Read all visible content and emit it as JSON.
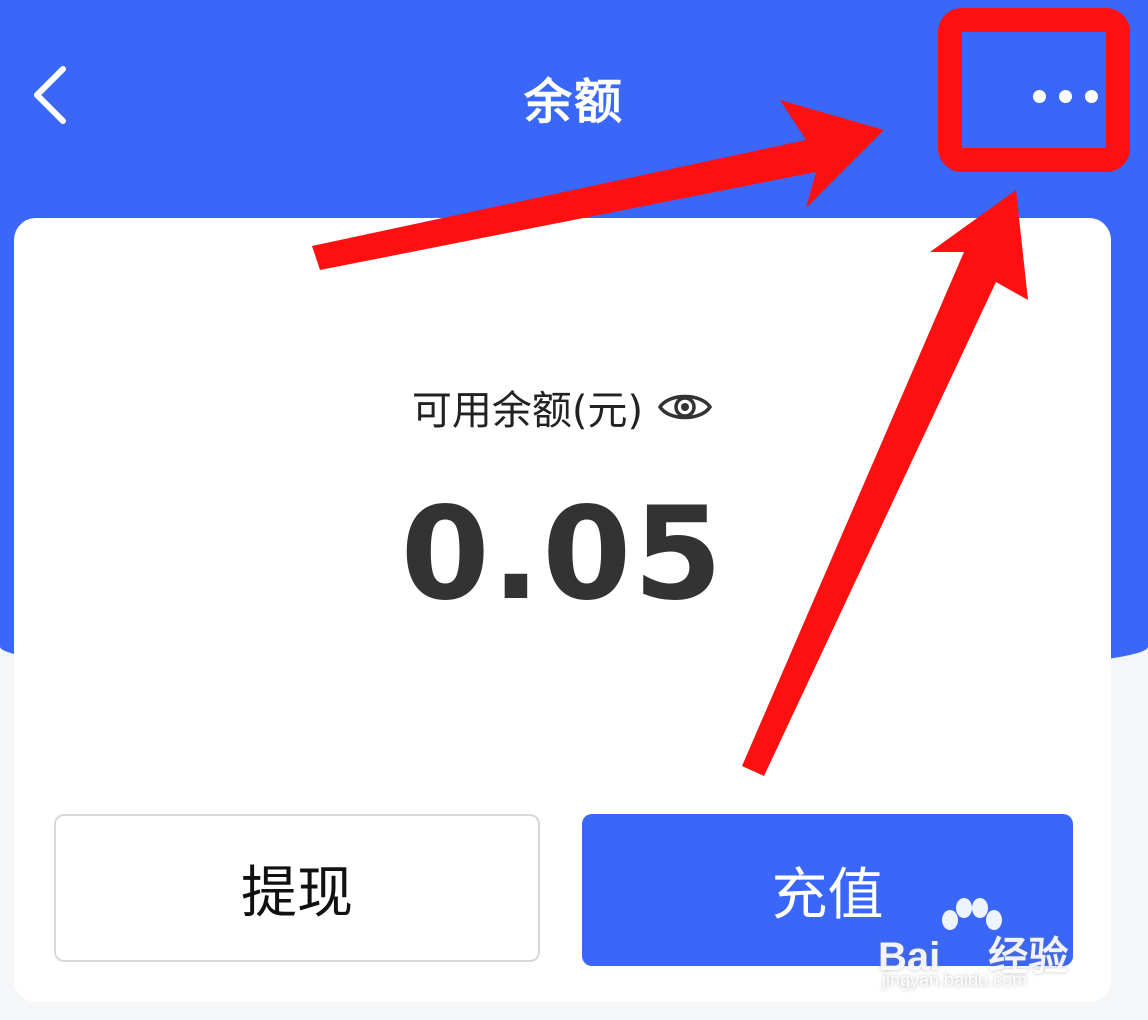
{
  "header": {
    "title": "余额",
    "back_icon": "chevron-left-icon",
    "more_icon": "more-dots-icon",
    "background_color": "#3a67f8"
  },
  "balance": {
    "label": "可用余额(元)",
    "visibility_icon": "eye-icon",
    "amount": "0.05"
  },
  "actions": {
    "withdraw_label": "提现",
    "recharge_label": "充值",
    "primary_color": "#3a67f8"
  },
  "annotation": {
    "color": "#ff1010"
  },
  "watermark": {
    "brand": "Bai",
    "brand_suffix": "经验",
    "site": "jingyan.baidu.com"
  }
}
